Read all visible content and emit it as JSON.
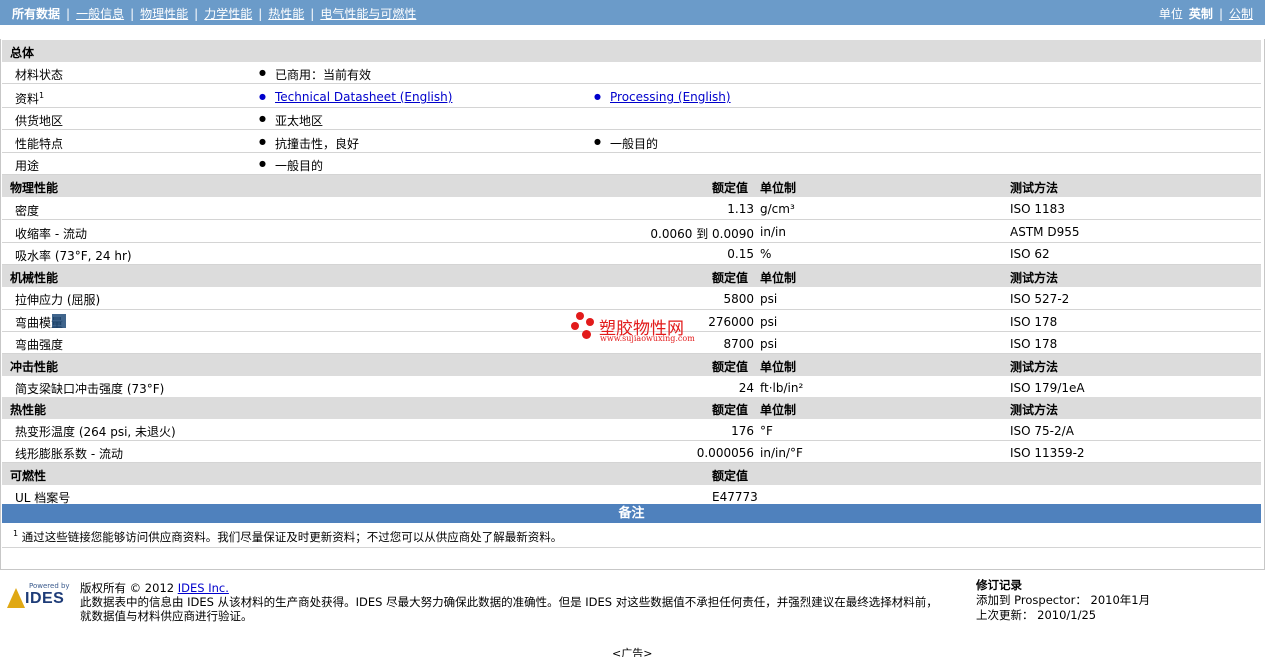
{
  "nav": {
    "active": "所有数据",
    "links": [
      "一般信息",
      "物理性能",
      "力学性能",
      "热性能",
      "电气性能与可燃性"
    ]
  },
  "units": {
    "label": "单位",
    "imperial": "英制",
    "metric": "公制"
  },
  "headers": {
    "nominal": "额定值",
    "unit": "单位制",
    "method": "测试方法"
  },
  "general": {
    "title": "总体",
    "rows": {
      "status_label": "材料状态",
      "status_value": "已商用：当前有效",
      "docs_label": "资料",
      "docs_sup": "1",
      "doc1": "Technical Datasheet (English)",
      "doc2": "Processing (English)",
      "region_label": "供货地区",
      "region_value": "亚太地区",
      "features_label": "性能特点",
      "feature1": "抗撞击性，良好",
      "feature2": "一般目的",
      "uses_label": "用途",
      "uses_value": "一般目的"
    }
  },
  "physical": {
    "title": "物理性能",
    "rows": [
      {
        "name": "密度",
        "value": "1.13",
        "unit": "g/cm³",
        "method": "ISO 1183"
      },
      {
        "name": "收缩率  - 流动",
        "value": "0.0060 到  0.0090",
        "unit": "in/in",
        "method": "ASTM D955"
      },
      {
        "name": "吸水率  (73°F, 24 hr)",
        "value": "0.15",
        "unit": "%",
        "method": "ISO 62"
      }
    ]
  },
  "mechanical": {
    "title": "机械性能",
    "rows": [
      {
        "name": "拉伸应力  (屈服)",
        "value": "5800",
        "unit": "psi",
        "method": "ISO 527-2"
      },
      {
        "name": "弯曲模量",
        "value": "276000",
        "unit": "psi",
        "method": "ISO 178"
      },
      {
        "name": "弯曲强度",
        "value": "8700",
        "unit": "psi",
        "method": "ISO 178"
      }
    ]
  },
  "impact": {
    "title": "冲击性能",
    "rows": [
      {
        "name": "简支梁缺口冲击强度  (73°F)",
        "value": "24",
        "unit": "ft·lb/in²",
        "method": "ISO 179/1eA"
      }
    ]
  },
  "thermal": {
    "title": "热性能",
    "rows": [
      {
        "name": "热变形温度  (264 psi, 未退火)",
        "value": "176",
        "unit": "°F",
        "method": "ISO 75-2/A"
      },
      {
        "name": "线形膨胀系数  - 流动",
        "value": "0.000056",
        "unit": "in/in/°F",
        "method": "ISO 11359-2"
      }
    ]
  },
  "flammability": {
    "title": "可燃性",
    "rows": [
      {
        "name": "UL 档案号",
        "value": "E47773"
      }
    ]
  },
  "notes": {
    "title": "备注",
    "sup": "1",
    "text": "通过这些链接您能够访问供应商资料。我们尽量保证及时更新资料；不过您可以从供应商处了解最新资料。"
  },
  "footer": {
    "powered": "Powered by",
    "logo": "IDES",
    "copyright_prefix": "版权所有 © 2012 ",
    "copyright_link": "IDES Inc.",
    "line2": "此数据表中的信息由  IDES 从该材料的生产商处获得。IDES 尽最大努力确保此数据的准确性。但是  IDES 对这些数据值不承担任何责任，并强烈建议在最终选择材料前，",
    "line3": "就数据值与材料供应商进行验证。",
    "rev_title": "修订记录",
    "rev_added": "添加到  Prospector：  2010年1月",
    "rev_updated": "上次更新：  2010/1/25",
    "ad": "<广告>"
  },
  "watermark": {
    "name": "塑胶物性网",
    "url": "www.sujiaowuxing.com"
  }
}
